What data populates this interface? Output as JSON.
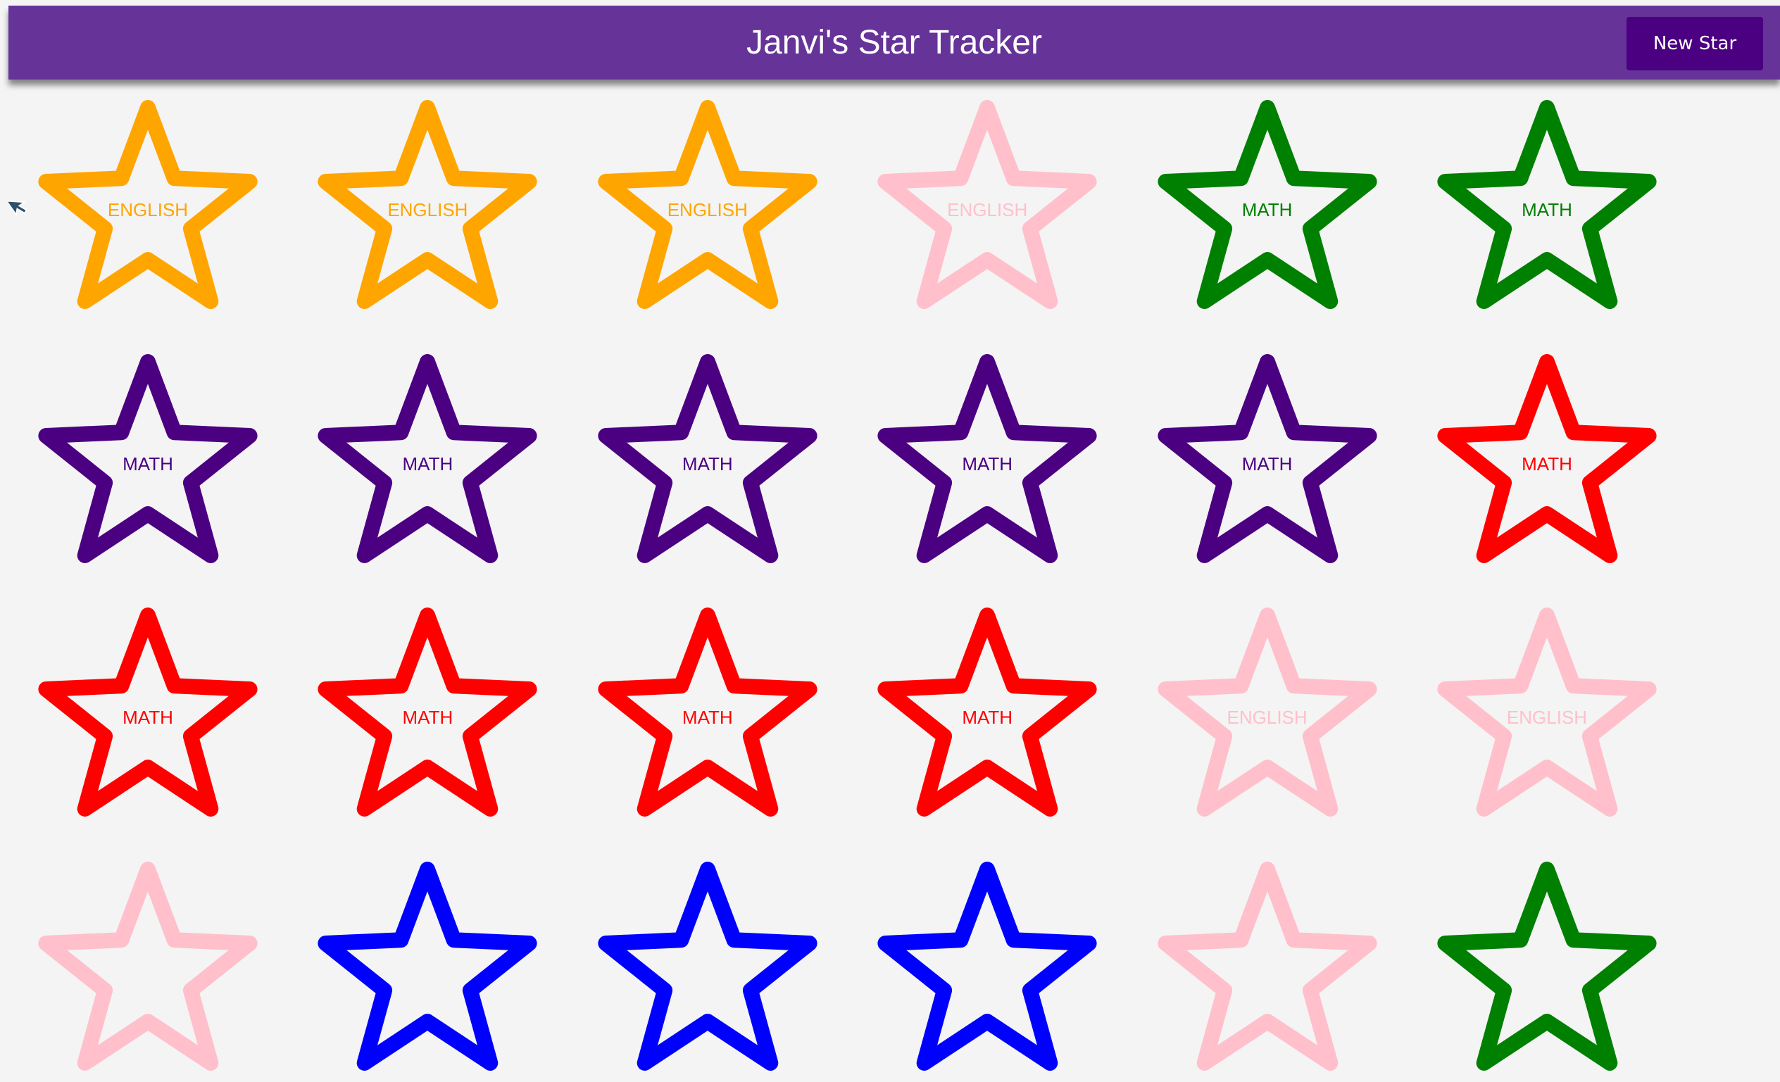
{
  "header": {
    "title": "Janvi's Star Tracker",
    "new_star_label": "New Star"
  },
  "icons": {
    "cursor": "pointer-cursor-icon"
  },
  "colors": {
    "header_bg": "#663399",
    "button_bg": "#4b0082",
    "page_bg": "#f4f4f4"
  },
  "stars": [
    {
      "label": "ENGLISH",
      "color": "#ffa500"
    },
    {
      "label": "ENGLISH",
      "color": "#ffa500"
    },
    {
      "label": "ENGLISH",
      "color": "#ffa500"
    },
    {
      "label": "ENGLISH",
      "color": "#ffc0cb"
    },
    {
      "label": "MATH",
      "color": "#008000"
    },
    {
      "label": "MATH",
      "color": "#008000"
    },
    {
      "label": "MATH",
      "color": "#4b0082"
    },
    {
      "label": "MATH",
      "color": "#4b0082"
    },
    {
      "label": "MATH",
      "color": "#4b0082"
    },
    {
      "label": "MATH",
      "color": "#4b0082"
    },
    {
      "label": "MATH",
      "color": "#4b0082"
    },
    {
      "label": "MATH",
      "color": "#ff0000"
    },
    {
      "label": "MATH",
      "color": "#ff0000"
    },
    {
      "label": "MATH",
      "color": "#ff0000"
    },
    {
      "label": "MATH",
      "color": "#ff0000"
    },
    {
      "label": "MATH",
      "color": "#ff0000"
    },
    {
      "label": "ENGLISH",
      "color": "#ffc0cb"
    },
    {
      "label": "ENGLISH",
      "color": "#ffc0cb"
    },
    {
      "label": "",
      "color": "#ffc0cb"
    },
    {
      "label": "",
      "color": "#0000ff"
    },
    {
      "label": "",
      "color": "#0000ff"
    },
    {
      "label": "",
      "color": "#0000ff"
    },
    {
      "label": "",
      "color": "#ffc0cb"
    },
    {
      "label": "",
      "color": "#008000"
    }
  ]
}
